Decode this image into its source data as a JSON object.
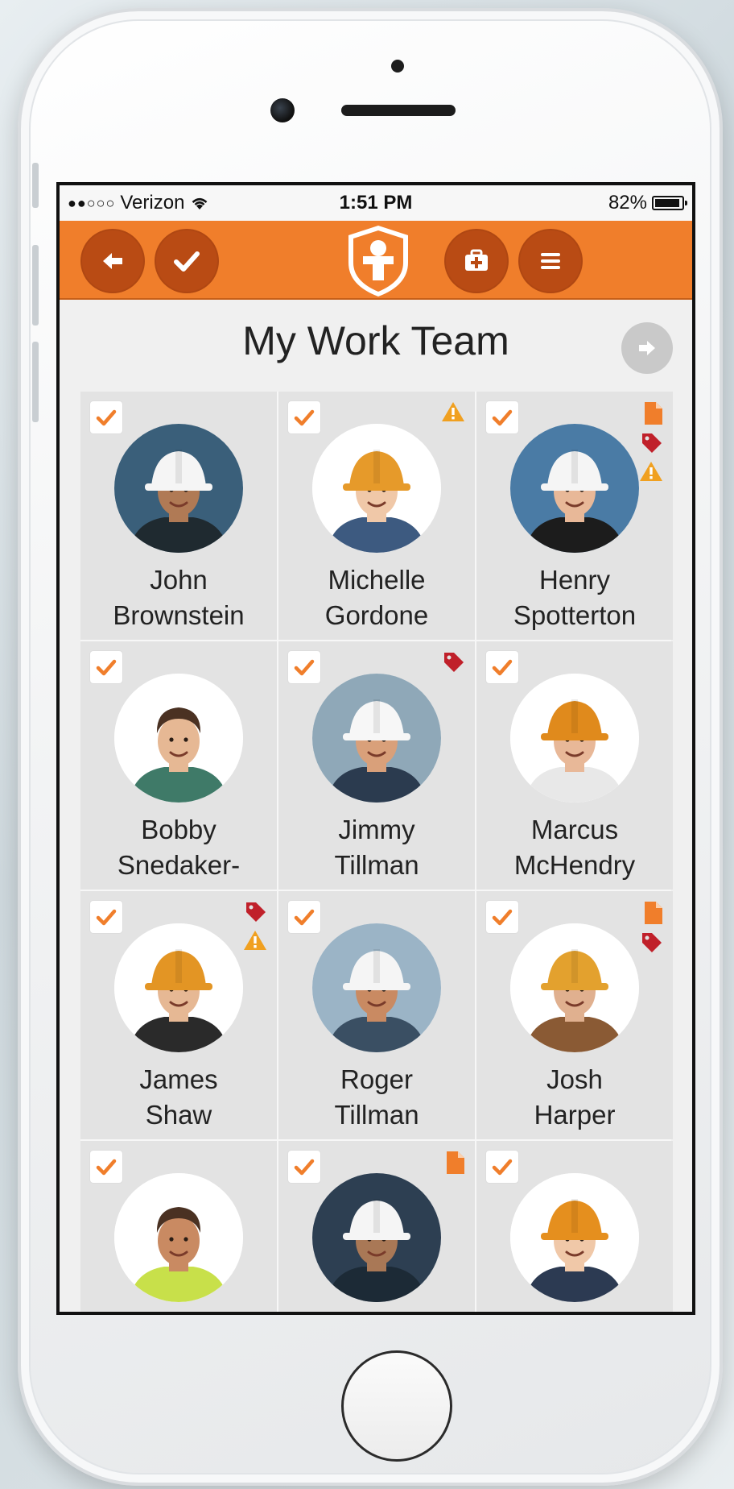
{
  "status": {
    "carrier": "Verizon",
    "time": "1:51 PM",
    "battery": "82%"
  },
  "nav": {
    "back_icon": "back-arrow-icon",
    "confirm_icon": "checkmark-icon",
    "logo_icon": "shield-worker-logo",
    "first_aid_icon": "first-aid-kit-icon",
    "menu_icon": "hamburger-menu-icon"
  },
  "page": {
    "title": "My Work Team"
  },
  "colors": {
    "accent": "#f07e2b",
    "accent_dark": "#b94b14",
    "warning": "#f0a020",
    "tag": "#c0202a"
  },
  "team": [
    {
      "first": "John",
      "last": "Brownstein",
      "checked": true,
      "badges": [],
      "photo_bg": "#3a5f7a",
      "helmet": "#f5f5f5",
      "shirt": "#1f2a30",
      "skin": "#b07a55"
    },
    {
      "first": "Michelle",
      "last": "Gordone",
      "checked": true,
      "badges": [
        "warning"
      ],
      "photo_bg": "#ffffff",
      "helmet": "#e69a2a",
      "shirt": "#3d5a80",
      "skin": "#f0c8a8"
    },
    {
      "first": "Henry",
      "last": "Spotterton",
      "checked": true,
      "badges": [
        "document",
        "tag",
        "warning"
      ],
      "photo_bg": "#4a7ba5",
      "helmet": "#f5f5f5",
      "shirt": "#1c1c1c",
      "skin": "#e8b898"
    },
    {
      "first": "Bobby",
      "last": "Snedaker-",
      "checked": true,
      "badges": [],
      "photo_bg": "#ffffff",
      "helmet": "",
      "shirt": "#3f7a68",
      "skin": "#e6b894"
    },
    {
      "first": "Jimmy",
      "last": "Tillman",
      "checked": true,
      "badges": [
        "tag"
      ],
      "photo_bg": "#8fa8b8",
      "helmet": "#f7f7f7",
      "shirt": "#2b3b4f",
      "skin": "#d9a07a"
    },
    {
      "first": "Marcus",
      "last": "McHendry",
      "checked": true,
      "badges": [],
      "photo_bg": "#ffffff",
      "helmet": "#e08a1c",
      "shirt": "#e8e8e8",
      "skin": "#e8b898"
    },
    {
      "first": "James",
      "last": "Shaw",
      "checked": true,
      "badges": [
        "tag",
        "warning"
      ],
      "photo_bg": "#ffffff",
      "helmet": "#e39524",
      "shirt": "#2a2a2a",
      "skin": "#e6b894"
    },
    {
      "first": "Roger",
      "last": "Tillman",
      "checked": true,
      "badges": [],
      "photo_bg": "#9bb4c6",
      "helmet": "#f5f5f5",
      "shirt": "#3a4f63",
      "skin": "#c98a62"
    },
    {
      "first": "Josh",
      "last": "Harper",
      "checked": true,
      "badges": [
        "document",
        "tag"
      ],
      "photo_bg": "#ffffff",
      "helmet": "#e3a12e",
      "shirt": "#8a5a34",
      "skin": "#e0b08f"
    },
    {
      "first": "",
      "last": "",
      "checked": true,
      "badges": [],
      "photo_bg": "#ffffff",
      "helmet": "",
      "shirt": "#c8e04a",
      "skin": "#c98a62"
    },
    {
      "first": "",
      "last": "",
      "checked": true,
      "badges": [
        "document"
      ],
      "photo_bg": "#2d3f52",
      "helmet": "#f5f5f5",
      "shirt": "#1c2a36",
      "skin": "#a97856"
    },
    {
      "first": "",
      "last": "",
      "checked": true,
      "badges": [],
      "photo_bg": "#ffffff",
      "helmet": "#e58f1e",
      "shirt": "#2c3a52",
      "skin": "#f0c8a8"
    }
  ]
}
